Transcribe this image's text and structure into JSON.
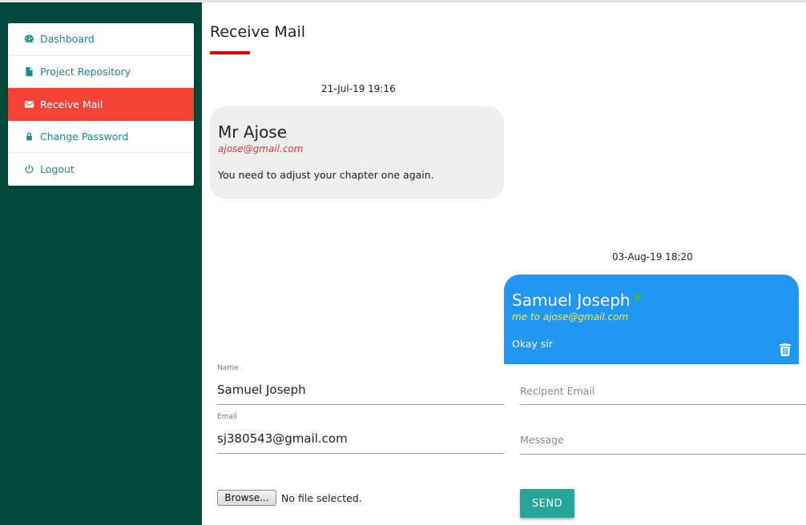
{
  "sidebar": {
    "items": [
      {
        "label": "Dashboard",
        "icon": "dashboard-icon"
      },
      {
        "label": "Project Repository",
        "icon": "file-icon"
      },
      {
        "label": "Receive Mail",
        "icon": "envelope-icon",
        "active": true
      },
      {
        "label": "Change Password",
        "icon": "lock-icon"
      },
      {
        "label": "Logout",
        "icon": "power-icon"
      }
    ],
    "active_color": "#f44336",
    "bg_color": "#014a3b"
  },
  "main": {
    "title": "Receive Mail",
    "messages": [
      {
        "timestamp": "21-Jul-19 19:16",
        "sender": "Mr Ajose",
        "address": "ajose@gmail.com",
        "text": "You need to adjust your chapter one again."
      },
      {
        "timestamp": "03-Aug-19 18:20",
        "sender": "Samuel Joseph",
        "address": "me to ajose@gmail.com",
        "text": "Okay sir"
      }
    ]
  },
  "form": {
    "name_label": "Name",
    "name_value": "Samuel Joseph",
    "email_label": "Email",
    "email_value": "sj380543@gmail.com",
    "recipient_placeholder": "Recipent Email",
    "message_placeholder": "Message",
    "browse_label": "Browse...",
    "file_status": "No file selected.",
    "send_label": "SEND"
  }
}
